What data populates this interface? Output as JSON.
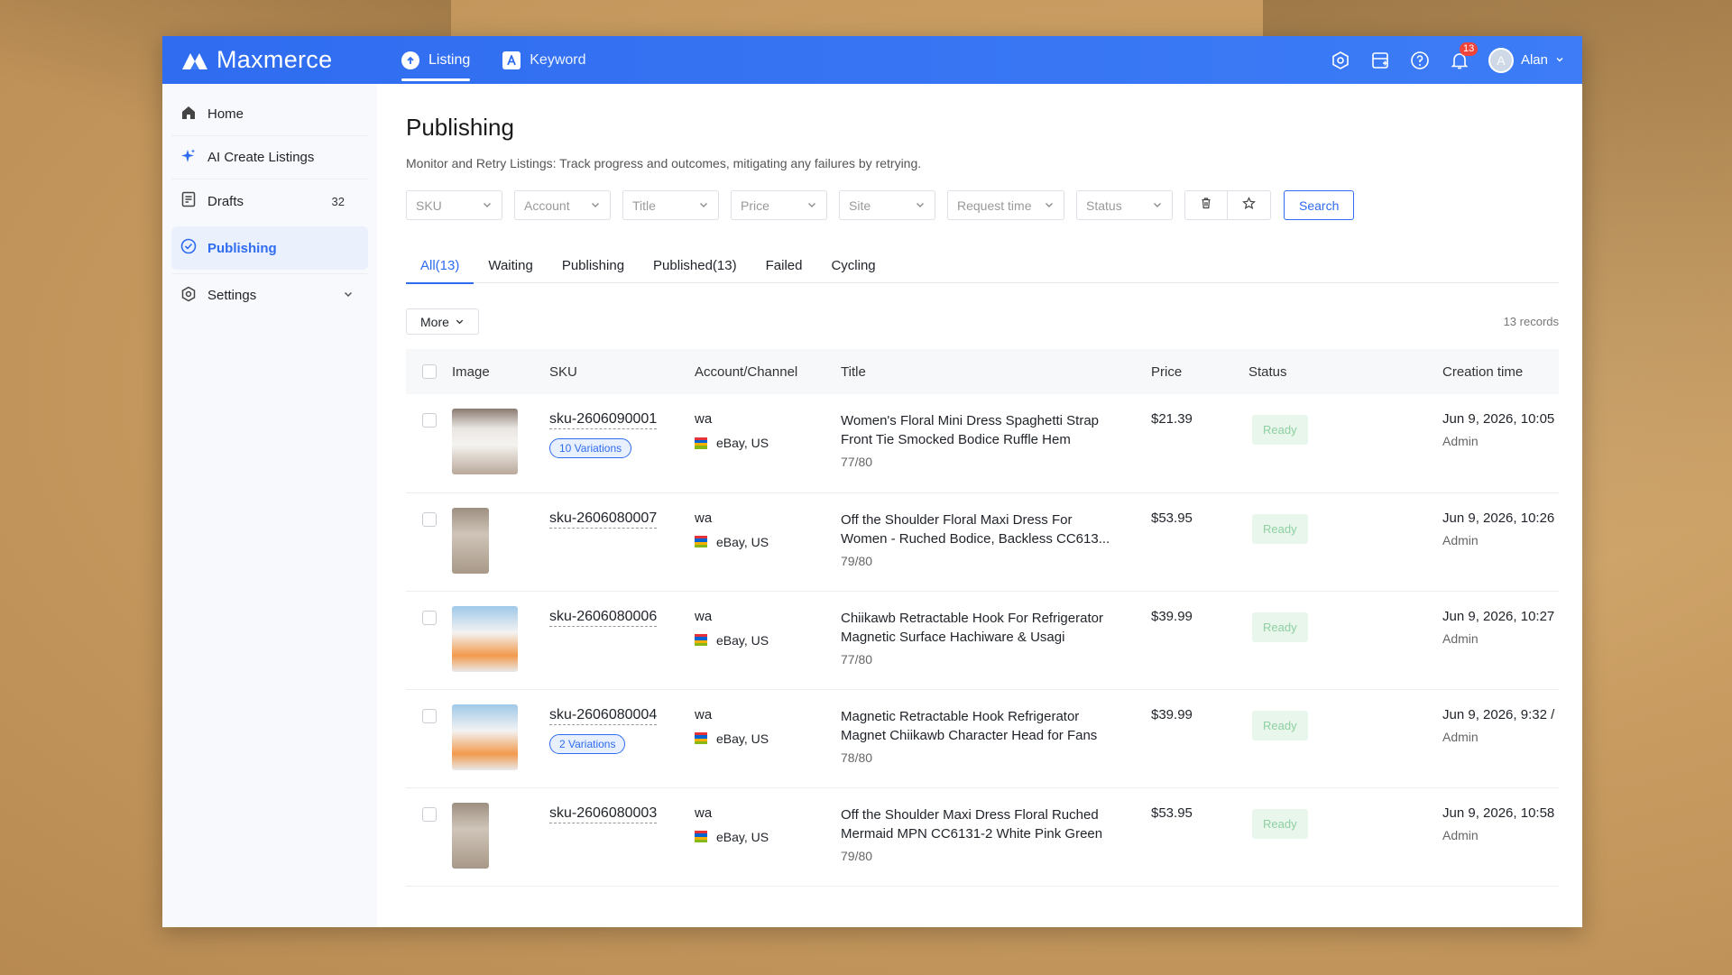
{
  "app": {
    "brand": "Maxmerce",
    "top_nav": [
      {
        "label": "Listing",
        "icon": "upload-icon",
        "active": true
      },
      {
        "label": "Keyword",
        "icon": "keyword-icon",
        "active": false
      }
    ],
    "notifications_count": "13",
    "user": {
      "initial": "A",
      "name": "Alan"
    }
  },
  "sidebar": {
    "items": [
      {
        "label": "Home",
        "icon": "home-icon"
      },
      {
        "label": "AI Create Listings",
        "icon": "sparkle-icon"
      },
      {
        "label": "Drafts",
        "icon": "drafts-icon",
        "count": "32"
      },
      {
        "label": "Publishing",
        "icon": "check-circle-icon",
        "active": true
      },
      {
        "label": "Settings",
        "icon": "gear-icon"
      }
    ]
  },
  "page": {
    "title": "Publishing",
    "description": "Monitor and Retry Listings: Track progress and outcomes, mitigating any failures by retrying."
  },
  "filters": {
    "sku": "SKU",
    "account": "Account",
    "title": "Title",
    "price": "Price",
    "site": "Site",
    "request_time": "Request time",
    "status": "Status",
    "search_label": "Search"
  },
  "tabs": [
    "All(13)",
    "Waiting",
    "Publishing",
    "Published(13)",
    "Failed",
    "Cycling"
  ],
  "toolbar": {
    "more_label": "More",
    "records": "13 records"
  },
  "table": {
    "columns": [
      "Image",
      "SKU",
      "Account/Channel",
      "Title",
      "Price",
      "Status",
      "Creation time"
    ],
    "rows": [
      {
        "image": "dress",
        "sku": "sku-2606090001",
        "variations": "10 Variations",
        "account": "wa",
        "channel": "eBay, US",
        "title": "Women's Floral Mini Dress Spaghetti Strap Front Tie Smocked Bodice Ruffle Hem",
        "length": "77/80",
        "price": "$21.39",
        "status": "Ready",
        "created": "Jun 9, 2026, 10:05",
        "creator": "Admin"
      },
      {
        "image": "dress2",
        "sku": "sku-2606080007",
        "variations": "",
        "account": "wa",
        "channel": "eBay, US",
        "title": "Off the Shoulder Floral Maxi Dress For Women - Ruched Bodice, Backless CC613...",
        "length": "79/80",
        "price": "$53.95",
        "status": "Ready",
        "created": "Jun 9, 2026, 10:26",
        "creator": "Admin"
      },
      {
        "image": "hook",
        "sku": "sku-2606080006",
        "variations": "",
        "account": "wa",
        "channel": "eBay, US",
        "title": "Chiikawb Retractable Hook For Refrigerator Magnetic Surface Hachiware & Usagi",
        "length": "77/80",
        "price": "$39.99",
        "status": "Ready",
        "created": "Jun 9, 2026, 10:27",
        "creator": "Admin"
      },
      {
        "image": "hook",
        "sku": "sku-2606080004",
        "variations": "2 Variations",
        "account": "wa",
        "channel": "eBay, US",
        "title": "Magnetic Retractable Hook Refrigerator Magnet Chiikawb Character Head for Fans",
        "length": "78/80",
        "price": "$39.99",
        "status": "Ready",
        "created": "Jun 9, 2026, 9:32 /",
        "creator": "Admin"
      },
      {
        "image": "dress2",
        "sku": "sku-2606080003",
        "variations": "",
        "account": "wa",
        "channel": "eBay, US",
        "title": "Off the Shoulder Maxi Dress Floral Ruched Mermaid MPN CC6131-2 White Pink Green",
        "length": "79/80",
        "price": "$53.95",
        "status": "Ready",
        "created": "Jun 9, 2026, 10:58",
        "creator": "Admin"
      }
    ]
  },
  "colors": {
    "primary": "#2f6cf0",
    "ready_bg": "#e8f6ec",
    "ready_text": "#8fd0a2"
  }
}
